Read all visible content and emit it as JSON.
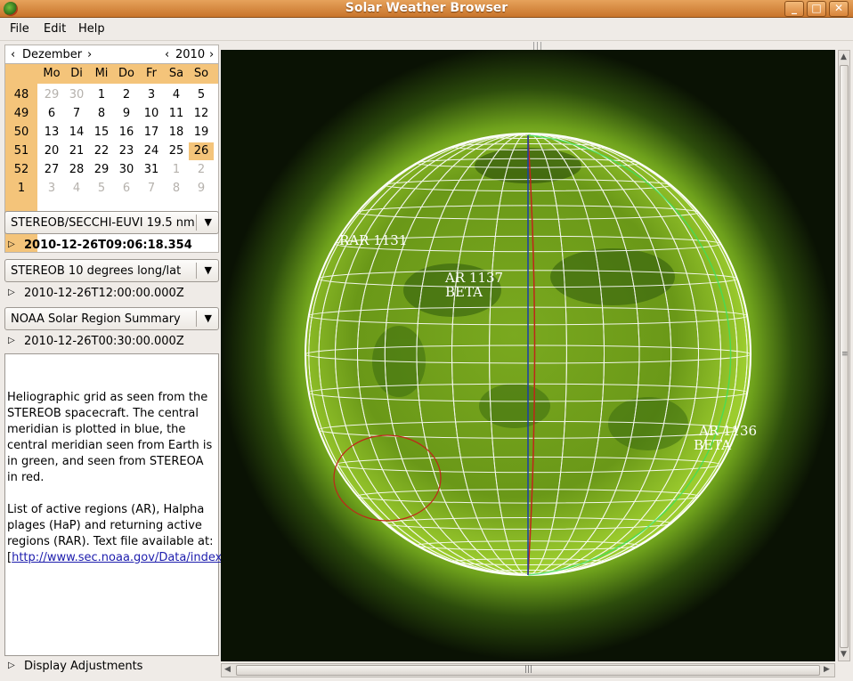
{
  "window": {
    "title": "Solar Weather Browser",
    "minimize": "_",
    "maximize": "□",
    "close": "✕"
  },
  "menu": [
    "File",
    "Edit",
    "Help"
  ],
  "calendar": {
    "month": "Dezember",
    "year": "2010",
    "prev": "‹",
    "next": "›",
    "weekdays": [
      "Mo",
      "Di",
      "Mi",
      "Do",
      "Fr",
      "Sa",
      "So"
    ],
    "weeks": [
      "48",
      "49",
      "50",
      "51",
      "52",
      "1"
    ],
    "days": [
      [
        "29",
        "30",
        "1",
        "2",
        "3",
        "4",
        "5"
      ],
      [
        "6",
        "7",
        "8",
        "9",
        "10",
        "11",
        "12"
      ],
      [
        "13",
        "14",
        "15",
        "16",
        "17",
        "18",
        "19"
      ],
      [
        "20",
        "21",
        "22",
        "23",
        "24",
        "25",
        "26"
      ],
      [
        "27",
        "28",
        "29",
        "30",
        "31",
        "1",
        "2"
      ],
      [
        "3",
        "4",
        "5",
        "6",
        "7",
        "8",
        "9"
      ]
    ],
    "selected_day": "26"
  },
  "image_source": {
    "value": "STEREOB/SECCHI-EUVI 19.5 nm",
    "timestamp": "2010-12-26T09:06:18.354"
  },
  "grid_overlay": {
    "value": "STEREOB 10 degrees long/lat",
    "timestamp": "2010-12-26T12:00:00.000Z"
  },
  "region_overlay": {
    "value": "NOAA Solar Region Summary",
    "timestamp": "2010-12-26T00:30:00.000Z"
  },
  "description": {
    "para1": "Heliographic grid as seen from the STEREOB spacecraft. The central meridian is plotted in blue, the central meridian seen from Earth is in green, and seen from STEREOA in red.",
    "para2": "List of active regions (AR), Halpha plages (HaP) and returning active regions (RAR). Text file available at:",
    "link_open": "[",
    "link": "http://www.sec.noaa.gov/Data/index.html",
    "link_close": "]"
  },
  "display_adjustments": "Display Adjustments",
  "sun_labels": {
    "rar1131": "RAR 1131",
    "ar1137": "AR 1137",
    "ar1137_type": "BETA",
    "ar1136": "AR 1136",
    "ar1136_type": "BETA"
  },
  "colors": {
    "titlebar": "#d7883f",
    "calendar_highlight": "#f4c47a",
    "sun_green": "#8fc31f",
    "meridian_blue": "#1a3fa8",
    "meridian_red": "#c0261a",
    "meridian_green": "#3de05a"
  }
}
